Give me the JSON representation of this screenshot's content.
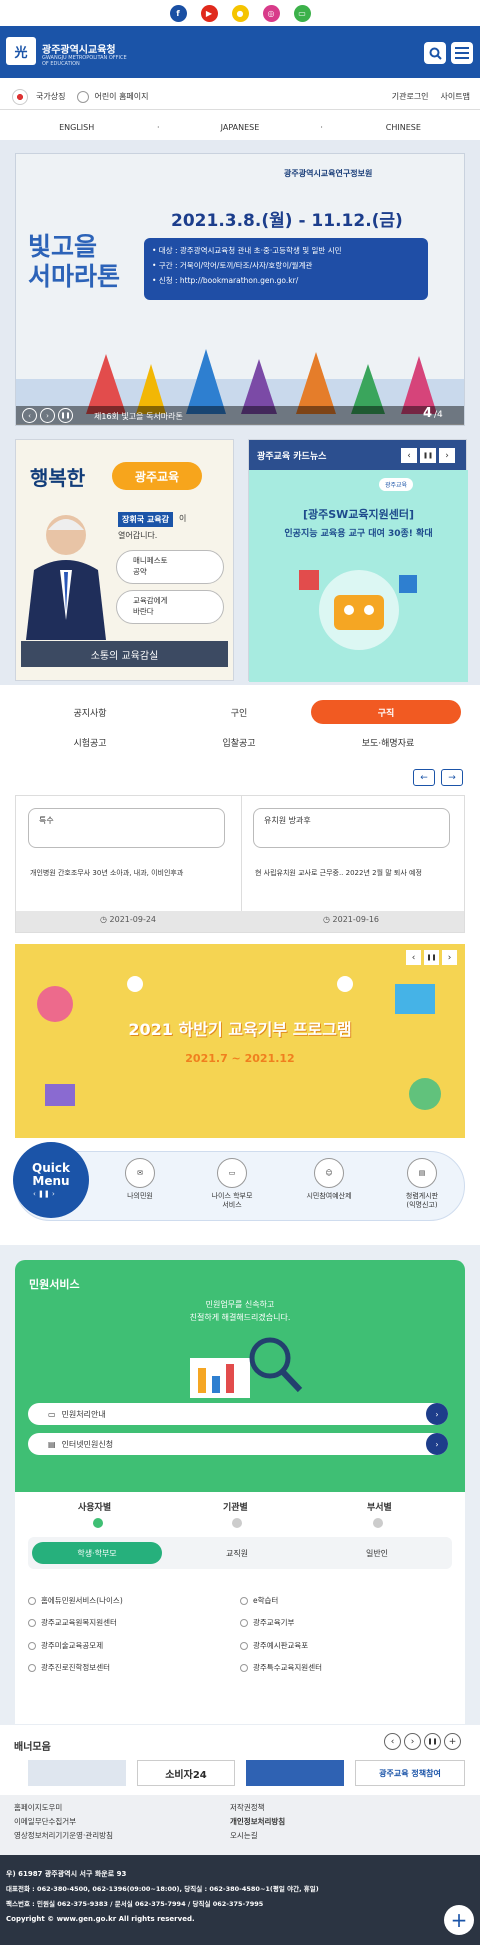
{
  "org": {
    "name": "광주광역시교육청",
    "name_en": "GWANGJU METROPOLITAN OFFICE OF EDUCATION"
  },
  "util": {
    "left": [
      "국가상징",
      "어린이 홈페이지"
    ],
    "right": [
      "기관로그인",
      "사이트맵"
    ]
  },
  "languages": [
    "ENGLISH",
    "JAPANESE",
    "CHINESE"
  ],
  "slide": {
    "org": "광주광역시교육연구정보원",
    "dates": "2021.3.8.(월) - 11.12.(금)",
    "title": "빛고을\n서마라톤",
    "target": "• 대상 : 광주광역시교육청 관내 초·중·고등학생 및 일반 시민",
    "sections": "• 구간 : 거북이/악어/토끼/타조/사자/호랑이/월계관",
    "apply": "• 신청 : http://bookmarathon.gen.go.kr/",
    "caption": "제16회 빛고을 독서마라톤",
    "page": "4",
    "total": "/4"
  },
  "card_left": {
    "slogan": "행복한",
    "slogan2": "광주교육",
    "name": "장휘국 교육감",
    "name_suffix": "이",
    "line2": "열어갑니다.",
    "btn1": "매니페스토\n공약",
    "btn2": "교육감에게\n바란다",
    "bottom": "소통의 교육감실"
  },
  "card_right": {
    "title": "광주교육 카드뉴스",
    "badge": "광주교육",
    "head": "[광주SW교육지원센터]",
    "body": "인공지능 교육용 교구 대여 30종! 확대"
  },
  "tabs": {
    "row1": [
      "공지사항",
      "구인",
      "구직"
    ],
    "row2": [
      "시험공고",
      "입찰공고",
      "보도·해명자료"
    ]
  },
  "notices": [
    {
      "title": "특수",
      "desc": "개인병원 간호조무사 30년 소아과, 내과, 이비인후과",
      "date": "2021-09-24"
    },
    {
      "title": "유치원 방과후",
      "desc": "현 사립유치원 교사로 근무중.. 2022년 2월 말 퇴사 예정",
      "date": "2021-09-16"
    }
  ],
  "event_banner": {
    "title": "2021 하반기 교육기부 프로그램",
    "period": "2021.7 ~ 2021.12"
  },
  "quick": {
    "title": "Quick\nMenu",
    "items": [
      "나의민원",
      "나이스 학부모\n서비스",
      "시민참여예산제",
      "청렴게시판\n(익명신고)"
    ]
  },
  "civil": {
    "title": "민원서비스",
    "lead": "민원업무를 신속하고\n친절하게 해결해드리겠습니다.",
    "btn1": "민원처리안내",
    "btn2": "인터넷민원신청"
  },
  "filters": {
    "tabs": [
      "사용자별",
      "기관별",
      "부서별"
    ],
    "sub": [
      "학생·학부모",
      "교직원",
      "일반인"
    ]
  },
  "services": [
    [
      "홈에듀민원서비스(나이스)",
      "e학습터"
    ],
    [
      "광주교교육원복지원센터",
      "광주교육기부"
    ],
    [
      "광주미술교육공모제",
      "광주예시판교육포"
    ],
    [
      "광주진로진학정보센터",
      "광주특수교육지원센터"
    ]
  ],
  "banners": {
    "title": "배너모음",
    "items": [
      "",
      "소비자24",
      "",
      "광주교육 정책참여"
    ]
  },
  "footer_links": [
    [
      "홈페이지도우미",
      "저작권정책"
    ],
    [
      "이메일무단수집거부",
      "개인정보처리방침"
    ],
    [
      "영상정보처리기기운영·관리방침",
      "오시는길"
    ]
  ],
  "footer": {
    "addr": "우) 61987 광주광역시 서구 화운로 93",
    "tel1": "대표전화 : 062-380-4500, 062-1396(09:00~18:00), 당직실 : 062-380-4580~1(평일 야간, 휴일)",
    "tel2": "팩스번호 : 민원실 062-375-9383 / 문서실 062-375-7994 / 당직실 062-375-7995",
    "copy": "Copyright © www.gen.go.kr All rights reserved."
  },
  "colors": {
    "primary": "#1b54a8",
    "accent": "#f15a22",
    "green": "#3fbf74"
  }
}
